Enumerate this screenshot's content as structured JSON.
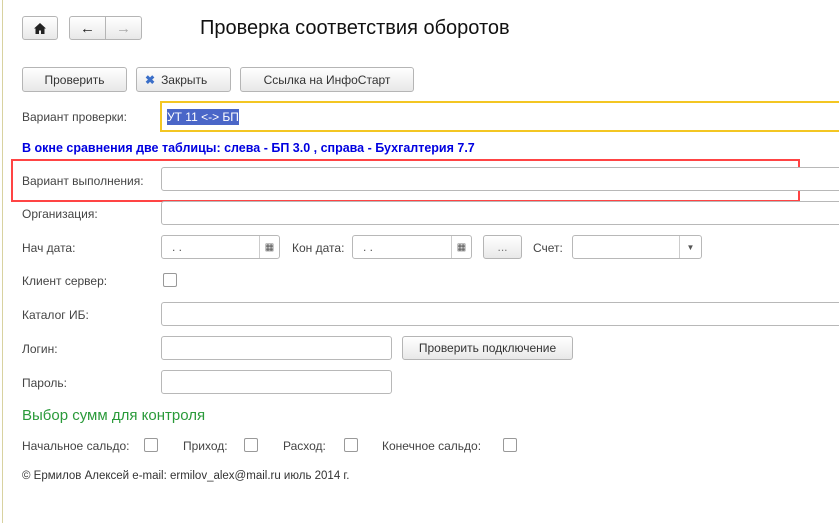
{
  "nav": {
    "home_icon": "home-icon",
    "back_icon": "arrow-left-icon",
    "forward_icon": "arrow-right-icon"
  },
  "title": "Проверка соответствия оборотов",
  "toolbar": {
    "check": "Проверить",
    "close": "Закрыть",
    "link": "Ссылка на ИнфоСтарт"
  },
  "form": {
    "check_variant_label": "Вариант проверки:",
    "check_variant_value": "УТ 11 <-> БП",
    "info_text": "В окне сравнения две таблицы: слева - БП 3.0 , справа - Бухгалтерия 7.7",
    "exec_variant_label": "Вариант выполнения:",
    "exec_variant_value": "",
    "org_label": "Организация:",
    "start_date_label": "Нач дата:",
    "start_date_value": ". .",
    "end_date_label": "Кон дата:",
    "end_date_value": ". .",
    "period_button": "...",
    "account_label": "Счет:",
    "client_server_label": "Клиент сервер:",
    "catalog_label": "Каталог ИБ:",
    "login_label": "Логин:",
    "check_connection": "Проверить подключение",
    "password_label": "Пароль:"
  },
  "sums": {
    "heading": "Выбор сумм для контроля",
    "opening": "Начальное сальдо:",
    "income": "Приход:",
    "expense": "Расход:",
    "closing": "Конечное сальдо:"
  },
  "footer": "© Ермилов Алексей e-mail: ermilov_alex@mail.ru июль 2014 г.",
  "colors": {
    "highlight": "#f44",
    "focus": "#f3c623",
    "selection": "#4a66c8",
    "info": "#0000e0",
    "heading": "#2a9a3a"
  }
}
